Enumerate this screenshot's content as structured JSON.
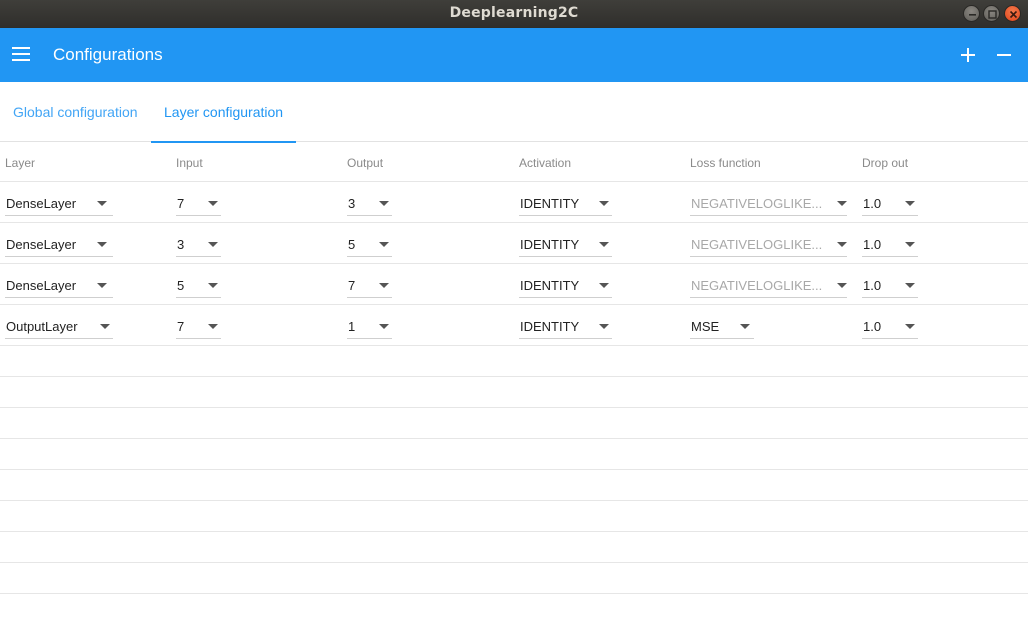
{
  "window": {
    "title": "Deeplearning2C"
  },
  "appbar": {
    "title": "Configurations"
  },
  "tabs": [
    {
      "label": "Global configuration",
      "active": false
    },
    {
      "label": "Layer configuration",
      "active": true
    }
  ],
  "table": {
    "headers": [
      "Layer",
      "Input",
      "Output",
      "Activation",
      "Loss function",
      "Drop out"
    ],
    "rows": [
      {
        "layer": "DenseLayer",
        "input": "7",
        "output": "3",
        "activation": "IDENTITY",
        "loss": "NEGATIVELOGLIKE...",
        "loss_enabled": false,
        "dropout": "1.0"
      },
      {
        "layer": "DenseLayer",
        "input": "3",
        "output": "5",
        "activation": "IDENTITY",
        "loss": "NEGATIVELOGLIKE...",
        "loss_enabled": false,
        "dropout": "1.0"
      },
      {
        "layer": "DenseLayer",
        "input": "5",
        "output": "7",
        "activation": "IDENTITY",
        "loss": "NEGATIVELOGLIKE...",
        "loss_enabled": false,
        "dropout": "1.0"
      },
      {
        "layer": "OutputLayer",
        "input": "7",
        "output": "1",
        "activation": "IDENTITY",
        "loss": "MSE",
        "loss_enabled": true,
        "dropout": "1.0"
      }
    ]
  },
  "colors": {
    "accent": "#2196f3",
    "tab_inactive": "#42a5f5",
    "disabled_text": "#a8a8a8"
  },
  "icons": {
    "menu": "menu-icon",
    "add": "plus-icon",
    "remove": "minus-icon"
  }
}
